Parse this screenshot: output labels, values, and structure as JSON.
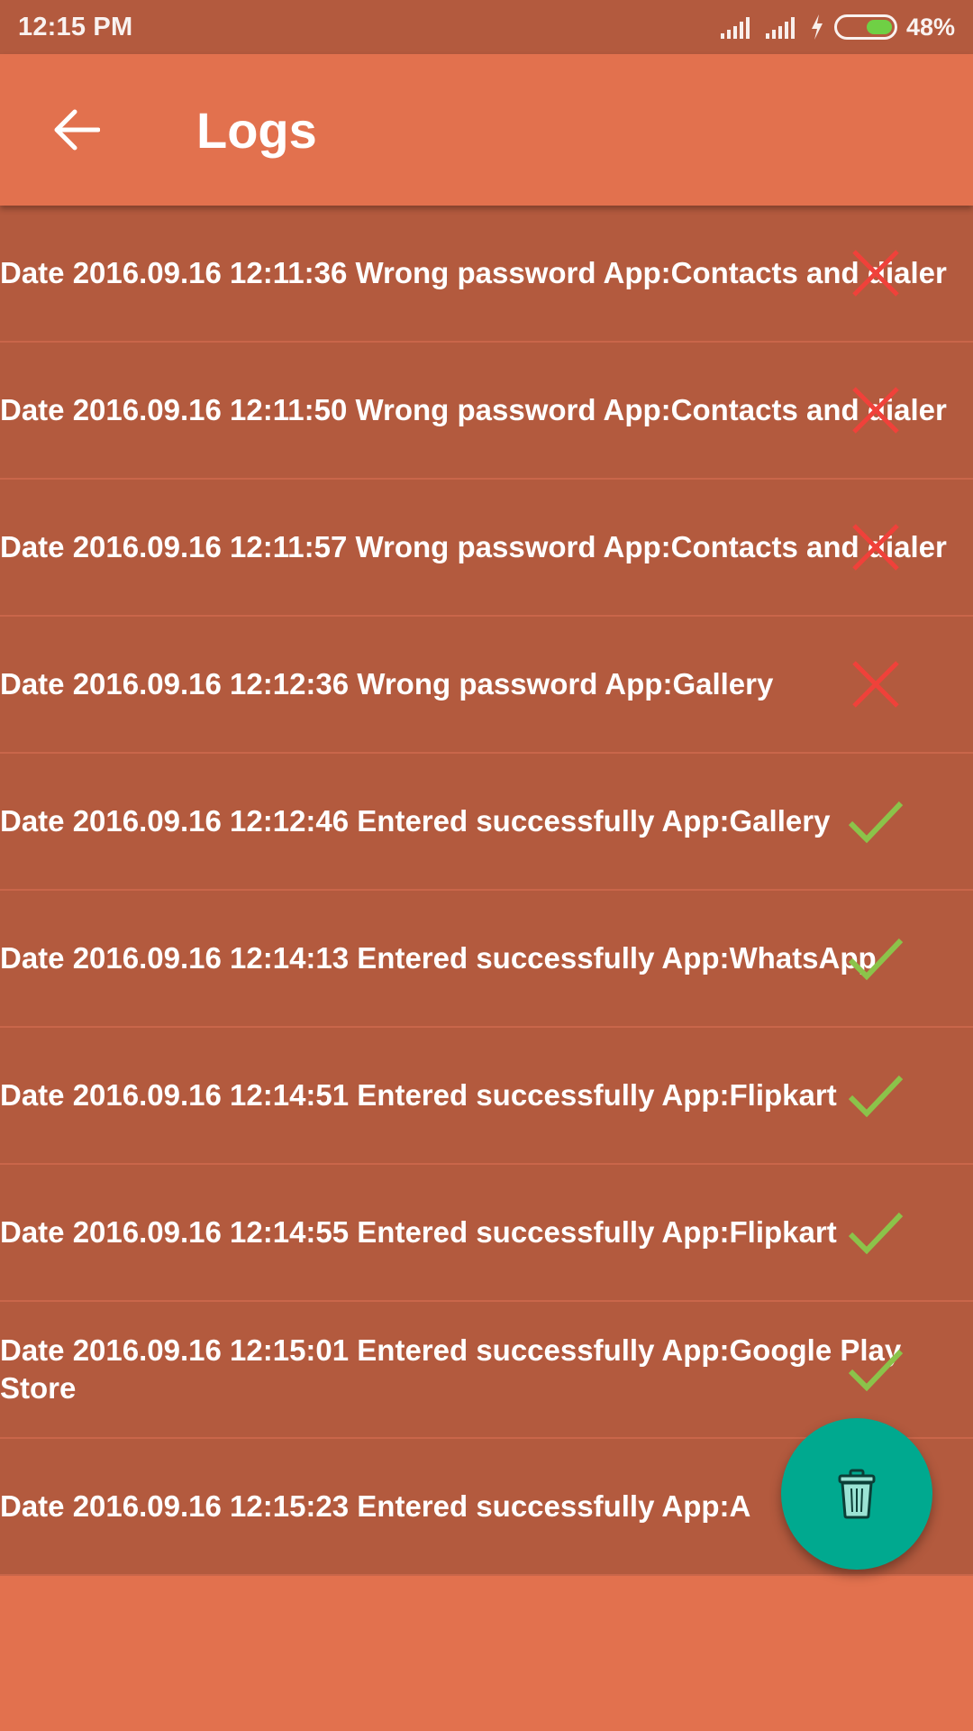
{
  "status_bar": {
    "time": "12:15 PM",
    "battery_percent": "48%",
    "battery_level": 0.48,
    "icons": [
      "signal-icon",
      "signal-icon",
      "charging-bolt-icon",
      "battery-icon"
    ]
  },
  "app_bar": {
    "title": "Logs",
    "back_icon": "arrow-left-icon"
  },
  "logs": [
    {
      "text": "Date 2016.09.16 12:11:36 Wrong password App:Contacts and dialer",
      "status": "fail"
    },
    {
      "text": "Date 2016.09.16 12:11:50 Wrong password App:Contacts and dialer",
      "status": "fail"
    },
    {
      "text": "Date 2016.09.16 12:11:57 Wrong password App:Contacts and dialer",
      "status": "fail"
    },
    {
      "text": "Date 2016.09.16 12:12:36 Wrong password App:Gallery",
      "status": "fail"
    },
    {
      "text": "Date 2016.09.16 12:12:46 Entered successfully App:Gallery",
      "status": "success"
    },
    {
      "text": "Date 2016.09.16 12:14:13 Entered successfully App:WhatsApp",
      "status": "success"
    },
    {
      "text": "Date 2016.09.16 12:14:51 Entered successfully App:Flipkart",
      "status": "success"
    },
    {
      "text": "Date 2016.09.16 12:14:55 Entered successfully App:Flipkart",
      "status": "success"
    },
    {
      "text": "Date 2016.09.16 12:15:01 Entered successfully App:Google Play Store",
      "status": "success"
    },
    {
      "text": "Date 2016.09.16 12:15:23 Entered successfully App:A",
      "status": "success"
    }
  ],
  "fab": {
    "icon": "trash-icon"
  },
  "colors": {
    "accent": "#E2714E",
    "row_background": "#B35A3E",
    "fab": "#00A98F",
    "fail": "#F0413A",
    "success": "#8BC34A"
  }
}
